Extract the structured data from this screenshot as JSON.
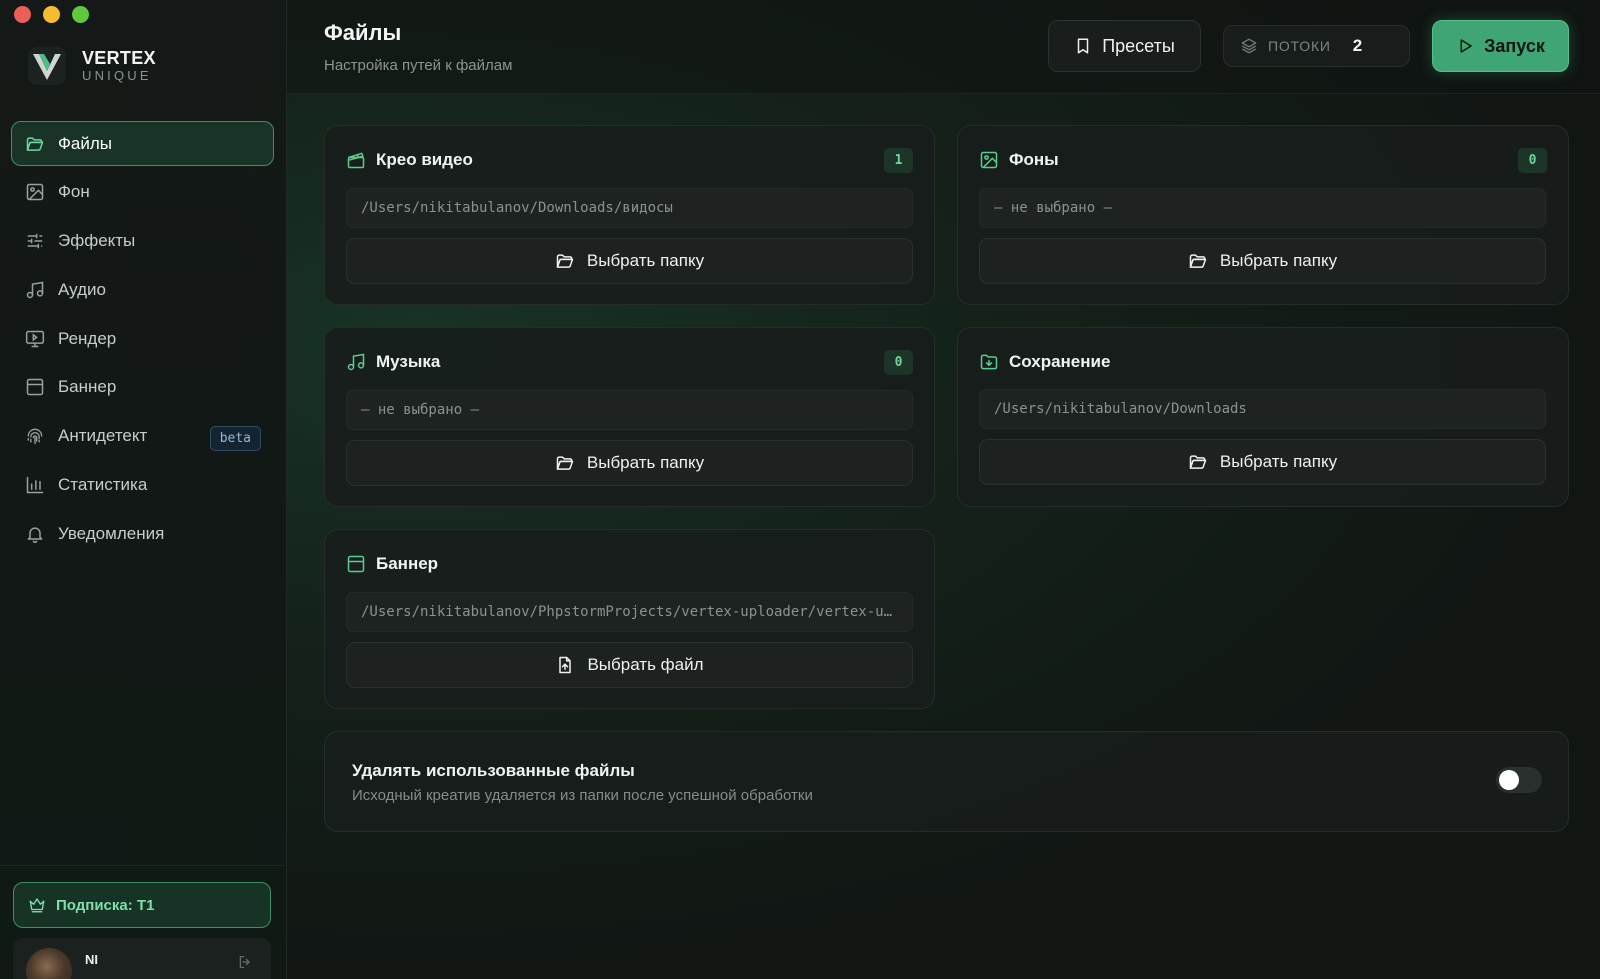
{
  "brand": {
    "name": "VERTEX",
    "sub": "UNIQUE"
  },
  "sidebar": {
    "items": [
      {
        "label": "Файлы",
        "icon": "folder-open-icon",
        "active": true
      },
      {
        "label": "Фон",
        "icon": "image-icon"
      },
      {
        "label": "Эффекты",
        "icon": "sliders-icon"
      },
      {
        "label": "Аудио",
        "icon": "music-note-icon"
      },
      {
        "label": "Рендер",
        "icon": "monitor-icon"
      },
      {
        "label": "Баннер",
        "icon": "browser-window-icon"
      },
      {
        "label": "Антидетект",
        "icon": "fingerprint-icon",
        "badge": "beta"
      },
      {
        "label": "Статистика",
        "icon": "bar-chart-icon"
      },
      {
        "label": "Уведомления",
        "icon": "bell-icon"
      }
    ],
    "subscription": "Подписка: T1",
    "user": {
      "name": "NI"
    }
  },
  "header": {
    "title": "Файлы",
    "subtitle": "Настройка путей к файлам",
    "presets_label": "Пресеты",
    "threads_label": "ПОТОКИ",
    "threads_value": "2",
    "run_label": "Запуск"
  },
  "cards": {
    "video": {
      "title": "Крео видео",
      "count": "1",
      "path": "/Users/nikitabulanov/Downloads/видосы",
      "button": "Выбрать папку"
    },
    "backgrounds": {
      "title": "Фоны",
      "count": "0",
      "path": "— не выбрано —",
      "button": "Выбрать папку"
    },
    "music": {
      "title": "Музыка",
      "count": "0",
      "path": "— не выбрано —",
      "button": "Выбрать папку"
    },
    "save": {
      "title": "Сохранение",
      "path": "/Users/nikitabulanov/Downloads",
      "button": "Выбрать папку"
    },
    "banner": {
      "title": "Баннер",
      "path": "/Users/nikitabulanov/PhpstormProjects/vertex-uploader/vertex-uploader/banner.png",
      "button": "Выбрать файл"
    }
  },
  "delete_used": {
    "title": "Удалять использованные файлы",
    "description": "Исходный креатив удаляется из папки после успешной обработки",
    "enabled": false
  },
  "colors": {
    "accent": "#3fa574",
    "accent_text": "#7ee0a8",
    "background": "#111513"
  }
}
